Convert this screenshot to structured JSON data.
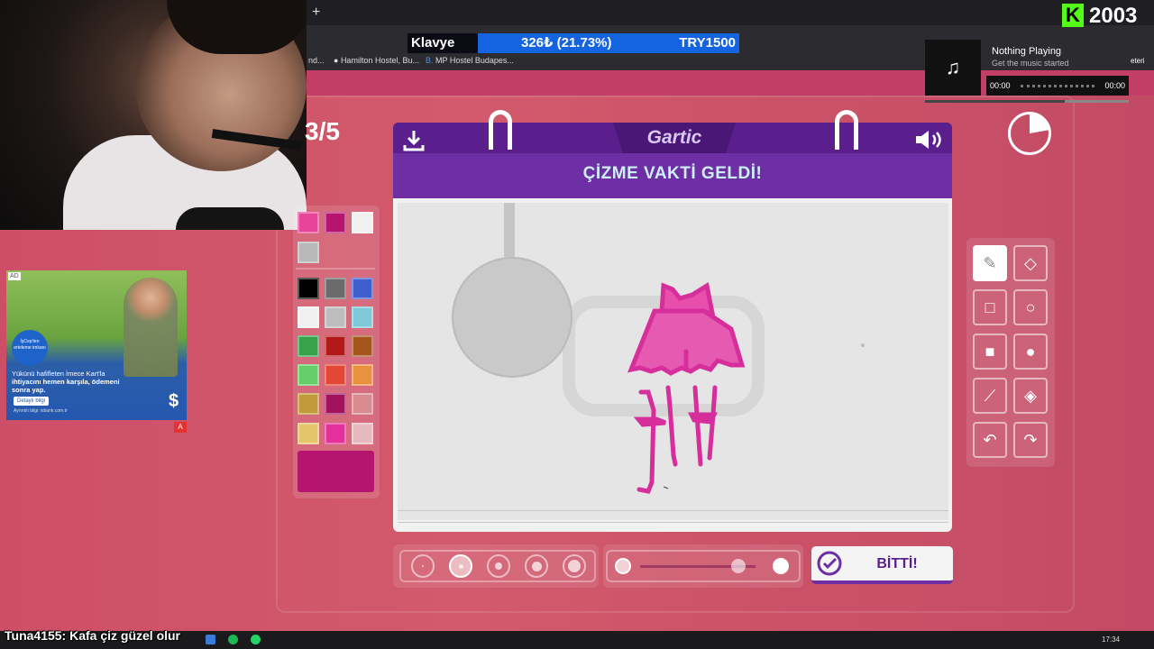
{
  "browser": {
    "bookmarks": [
      "nd...",
      "Hamilton Hostel, Bu...",
      "MP Hostel Budapes..."
    ],
    "bookmark_right": "eteri",
    "new_tab_symbol": "+"
  },
  "stream": {
    "klavye": {
      "label": "Klavye",
      "value": "326₺ (21.73%)",
      "goal": "TRY1500"
    },
    "kick_count": "2003",
    "kick_logo": "K",
    "music": {
      "title": "Nothing Playing",
      "subtitle": "Get the music started",
      "time_start": "00:00",
      "time_end": "00:00"
    },
    "chat": {
      "user": "Tuna4155",
      "message": ": Kafa çiz güzel olur"
    }
  },
  "ad": {
    "badge": "AD",
    "circle_text": "İşCep'ten erteleme imkanı",
    "headline": "Yükünü hafifleten İmece Kart'la",
    "headline_strong": "ihtiyacını hemen karşıla, ödemeni sonra yap.",
    "button": "Detaylı bilgi",
    "footer": "Ayrıntılı bilgi: isbank.com.tr",
    "dollar": "$",
    "flag": "A"
  },
  "game": {
    "round": "3/5",
    "logo": "Gartic",
    "prompt": "ÇİZME VAKTİ GELDİ!",
    "done_button": "BİTTİ!",
    "palette": [
      {
        "color": "#e8459a"
      },
      {
        "color": "#b5146f"
      },
      {
        "color": "#f0f0f0"
      },
      {
        "color": "#b9b9b9"
      },
      {
        "color": "#000000"
      },
      {
        "color": "#6b6b6b"
      },
      {
        "color": "#3f5fcf"
      },
      {
        "color": "#f0f0f0"
      },
      {
        "color": "#bdbdbd"
      },
      {
        "color": "#7ec8d8"
      },
      {
        "color": "#36a24a"
      },
      {
        "color": "#b21a1a"
      },
      {
        "color": "#a5561f"
      },
      {
        "color": "#67cf6a"
      },
      {
        "color": "#e34834"
      },
      {
        "color": "#e8923f"
      },
      {
        "color": "#c39a3b"
      },
      {
        "color": "#a3125e"
      },
      {
        "color": "#d98c8f"
      },
      {
        "color": "#e4c56a"
      },
      {
        "color": "#e3309b"
      },
      {
        "color": "#e6b9c1"
      }
    ],
    "current_color": "#b5146f",
    "tools": [
      "pencil-icon",
      "eraser-icon",
      "rect-outline-icon",
      "circle-outline-icon",
      "rect-filled-icon",
      "circle-filled-icon",
      "line-icon",
      "fill-bucket-icon",
      "undo-icon",
      "redo-icon"
    ],
    "brush_sizes": 5,
    "active_size_index": 1,
    "opacity_level": 0.85
  },
  "taskbar": {
    "clock": "17:34"
  },
  "colors": {
    "accent": "#6d2fa3",
    "page_bg": "#d9566f",
    "drawing": "#d62f9c"
  }
}
